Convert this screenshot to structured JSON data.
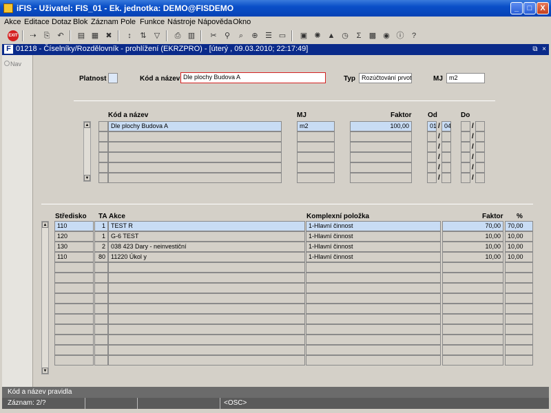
{
  "window": {
    "title": "iFIS - Uživatel: FIS_01 - Ek. jednotka: DEMO@FISDEMO",
    "min": "_",
    "max": "□",
    "close": "X"
  },
  "menu": [
    "Akce",
    "Editace",
    "Dotaz",
    "Blok",
    "Záznam",
    "Pole",
    "Funkce",
    "Nástroje",
    "Nápověda",
    "Okno"
  ],
  "toolbar": {
    "exit": "EXIT",
    "sum": "Σ",
    "help": "?"
  },
  "form_title": "01218 - Číselníky/Rozdělovník - prohlížení (EKRZPRO) - [úterý , 09.03.2010; 22:17:49]",
  "nav_label": "Nav",
  "header": {
    "platnost_label": "Platnost",
    "platnost_value": "",
    "kod_label": "Kód a název",
    "kod_value": "Dle plochy Budova A",
    "typ_label": "Typ",
    "typ_value": "Rozúčtování prvotn",
    "mj_label": "MJ",
    "mj_value": "m2"
  },
  "upper_table": {
    "headers": {
      "kod": "Kód a název",
      "mj": "MJ",
      "faktor": "Faktor",
      "od": "Od",
      "do": "Do"
    },
    "rows": [
      {
        "kod": "Dle plochy Budova A",
        "mj": "m2",
        "faktor": "100,00",
        "od1": "01",
        "od2": "04",
        "do1": "",
        "do2": ""
      },
      {
        "kod": "",
        "mj": "",
        "faktor": "",
        "od1": "",
        "od2": "",
        "do1": "",
        "do2": ""
      },
      {
        "kod": "",
        "mj": "",
        "faktor": "",
        "od1": "",
        "od2": "",
        "do1": "",
        "do2": ""
      },
      {
        "kod": "",
        "mj": "",
        "faktor": "",
        "od1": "",
        "od2": "",
        "do1": "",
        "do2": ""
      },
      {
        "kod": "",
        "mj": "",
        "faktor": "",
        "od1": "",
        "od2": "",
        "do1": "",
        "do2": ""
      },
      {
        "kod": "",
        "mj": "",
        "faktor": "",
        "od1": "",
        "od2": "",
        "do1": "",
        "do2": ""
      }
    ]
  },
  "lower_table": {
    "headers": {
      "stredisko": "Středisko",
      "ta": "TA",
      "akce": "Akce",
      "komplexni": "Komplexní položka",
      "faktor": "Faktor",
      "pct": "%"
    },
    "rows": [
      {
        "stredisko": "110",
        "ta": "1",
        "akce": "TEST R",
        "komplexni": "1-Hlavní činnost",
        "faktor": "70,00",
        "pct": "70,00"
      },
      {
        "stredisko": "120",
        "ta": "1",
        "akce": "G-6 TEST",
        "komplexni": "1-Hlavní činnost",
        "faktor": "10,00",
        "pct": "10,00"
      },
      {
        "stredisko": "130",
        "ta": "2",
        "akce": "038 423 Dary - neinvestiční",
        "komplexni": "1-Hlavní činnost",
        "faktor": "10,00",
        "pct": "10,00"
      },
      {
        "stredisko": "110",
        "ta": "80",
        "akce": "11220 Úkol y",
        "komplexni": "1-Hlavní činnost",
        "faktor": "10,00",
        "pct": "10,00"
      },
      {
        "stredisko": "",
        "ta": "",
        "akce": "",
        "komplexni": "",
        "faktor": "",
        "pct": ""
      },
      {
        "stredisko": "",
        "ta": "",
        "akce": "",
        "komplexni": "",
        "faktor": "",
        "pct": ""
      },
      {
        "stredisko": "",
        "ta": "",
        "akce": "",
        "komplexni": "",
        "faktor": "",
        "pct": ""
      },
      {
        "stredisko": "",
        "ta": "",
        "akce": "",
        "komplexni": "",
        "faktor": "",
        "pct": ""
      },
      {
        "stredisko": "",
        "ta": "",
        "akce": "",
        "komplexni": "",
        "faktor": "",
        "pct": ""
      },
      {
        "stredisko": "",
        "ta": "",
        "akce": "",
        "komplexni": "",
        "faktor": "",
        "pct": ""
      },
      {
        "stredisko": "",
        "ta": "",
        "akce": "",
        "komplexni": "",
        "faktor": "",
        "pct": ""
      },
      {
        "stredisko": "",
        "ta": "",
        "akce": "",
        "komplexni": "",
        "faktor": "",
        "pct": ""
      },
      {
        "stredisko": "",
        "ta": "",
        "akce": "",
        "komplexni": "",
        "faktor": "",
        "pct": ""
      },
      {
        "stredisko": "",
        "ta": "",
        "akce": "",
        "komplexni": "",
        "faktor": "",
        "pct": ""
      }
    ]
  },
  "status": {
    "hint": "Kód a název pravidla",
    "record": "Záznam: 2/?",
    "mode": "<OSC>"
  }
}
